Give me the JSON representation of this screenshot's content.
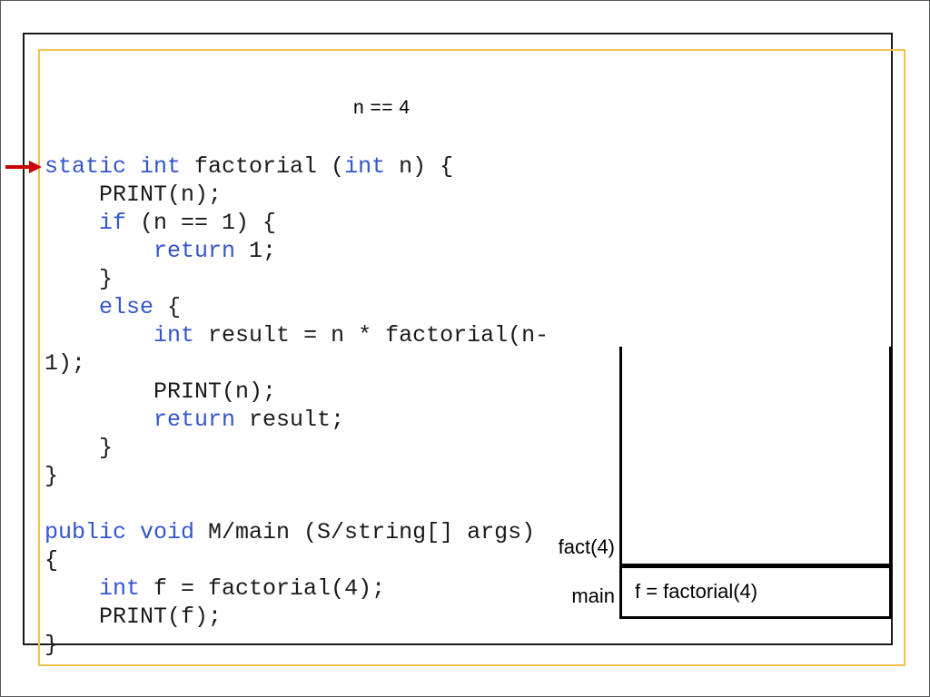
{
  "slide": {
    "annotation": "n == 4",
    "arrow_color": "#cc0000",
    "keyword_color": "#3355cc",
    "frame_outer_color": "#1a1a1a",
    "frame_accent_color": "#f2c14e"
  },
  "code": {
    "language": "java",
    "lines": [
      {
        "indent": 0,
        "tokens": [
          {
            "t": "static int",
            "kw": true
          },
          {
            "t": " factorial (",
            "kw": false
          },
          {
            "t": "int",
            "kw": true
          },
          {
            "t": " n) {",
            "kw": false
          }
        ]
      },
      {
        "indent": 1,
        "tokens": [
          {
            "t": "PRINT(n);",
            "kw": false
          }
        ]
      },
      {
        "indent": 1,
        "tokens": [
          {
            "t": "if",
            "kw": true
          },
          {
            "t": " (n == 1) {",
            "kw": false
          }
        ]
      },
      {
        "indent": 2,
        "tokens": [
          {
            "t": "return",
            "kw": true
          },
          {
            "t": " 1;",
            "kw": false
          }
        ]
      },
      {
        "indent": 1,
        "tokens": [
          {
            "t": "}",
            "kw": false
          }
        ]
      },
      {
        "indent": 1,
        "tokens": [
          {
            "t": "else",
            "kw": true
          },
          {
            "t": " {",
            "kw": false
          }
        ]
      },
      {
        "indent": 2,
        "tokens": [
          {
            "t": "int",
            "kw": true
          },
          {
            "t": " result = n * factorial(n-",
            "kw": false
          }
        ]
      },
      {
        "indent": 0,
        "tokens": [
          {
            "t": "1);",
            "kw": false
          }
        ]
      },
      {
        "indent": 2,
        "tokens": [
          {
            "t": "PRINT(n);",
            "kw": false
          }
        ]
      },
      {
        "indent": 2,
        "tokens": [
          {
            "t": "return",
            "kw": true
          },
          {
            "t": " result;",
            "kw": false
          }
        ]
      },
      {
        "indent": 1,
        "tokens": [
          {
            "t": "}",
            "kw": false
          }
        ]
      },
      {
        "indent": 0,
        "tokens": [
          {
            "t": "}",
            "kw": false
          }
        ]
      },
      {
        "indent": 0,
        "tokens": []
      },
      {
        "indent": 0,
        "tokens": [
          {
            "t": "public void",
            "kw": true
          },
          {
            "t": " M/main (S/string[] args)",
            "kw": false
          }
        ]
      },
      {
        "indent": 0,
        "tokens": [
          {
            "t": "{",
            "kw": false
          }
        ]
      },
      {
        "indent": 1,
        "tokens": [
          {
            "t": "int",
            "kw": true
          },
          {
            "t": " f = factorial(4);",
            "kw": false
          }
        ]
      },
      {
        "indent": 1,
        "tokens": [
          {
            "t": "PRINT(f);",
            "kw": false
          }
        ]
      },
      {
        "indent": 0,
        "tokens": [
          {
            "t": "}",
            "kw": false
          }
        ]
      }
    ]
  },
  "call_stack": {
    "frames": [
      {
        "label": "fact(4)",
        "content": ""
      },
      {
        "label": "main",
        "content": "f = factorial(4)"
      }
    ]
  }
}
